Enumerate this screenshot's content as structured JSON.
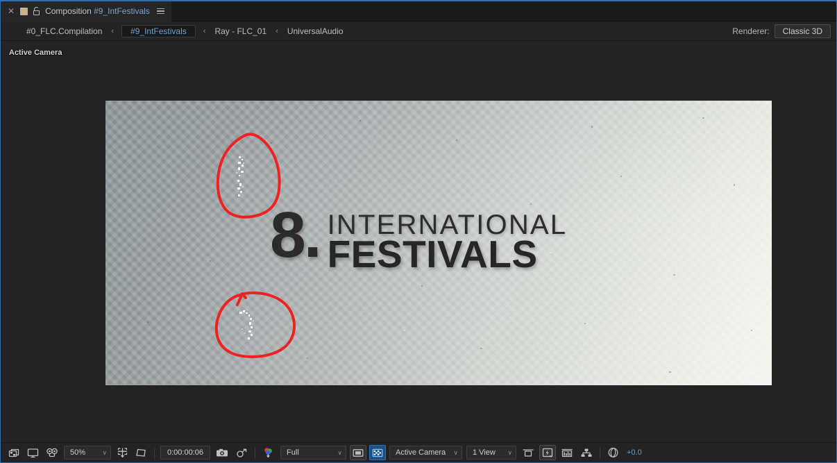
{
  "tab": {
    "close_icon": "close-icon",
    "color_swatch": "#c8b188",
    "lock_icon": "lock-icon",
    "title_prefix": "Composition ",
    "title_name": "#9_IntFestivals",
    "menu_icon": "panel-menu-icon"
  },
  "breadcrumb": {
    "separator": "‹",
    "items": [
      {
        "label": "#0_FLC.Compilation",
        "selected": false
      },
      {
        "label": "#9_IntFestivals",
        "selected": true
      },
      {
        "label": "Ray - FLC_01",
        "selected": false
      },
      {
        "label": "UniversalAudio",
        "selected": false
      }
    ]
  },
  "renderer": {
    "label": "Renderer:",
    "value": "Classic 3D"
  },
  "viewer": {
    "camera_label": "Active Camera",
    "composition": {
      "number": "8.",
      "line1": "INTERNATIONAL",
      "line2": "FESTIVALS",
      "annotation_color": "#ee2222",
      "annotations": [
        {
          "name": "annotation-circle-top"
        },
        {
          "name": "annotation-circle-bottom"
        }
      ]
    }
  },
  "bottom_toolbar": {
    "toggle_transparency_grid_icon": "transparency-grid-icon",
    "toggle_mask_icon": "display-monitor-icon",
    "toggle_3d_glasses_icon": "3d-view-icon",
    "zoom": {
      "value": "50%",
      "chevron": "∨"
    },
    "region_of_interest_icon": "region-of-interest-icon",
    "mask_shape_icon": "mask-shape-icon",
    "timecode": "0:00:00:06",
    "snapshot_icon": "camera-snapshot-icon",
    "show_snapshot_icon": "show-snapshot-icon",
    "channels_icon": "show-channel-icon",
    "resolution": {
      "value": "Full",
      "chevron": "∨"
    },
    "region_toggle_icon": "region-toggle-icon",
    "transparency_toggle_icon": "transparency-toggle-icon",
    "camera_select": {
      "value": "Active Camera",
      "chevron": "∨"
    },
    "view_layout": {
      "value": "1 View",
      "chevron": "∨"
    },
    "pixel_aspect_icon": "pixel-aspect-ratio-icon",
    "fast_previews_icon": "fast-previews-icon",
    "timeline_icon": "timeline-graph-icon",
    "comp_flowchart_icon": "comp-flowchart-icon",
    "exposure_icon": "exposure-aperture-icon",
    "exposure_value": "+0.0"
  },
  "colors": {
    "accent_blue": "#2f6fb3",
    "link_blue": "#6f9fd0",
    "panel_bg": "#232323",
    "tab_bg": "#1b1b1b"
  }
}
